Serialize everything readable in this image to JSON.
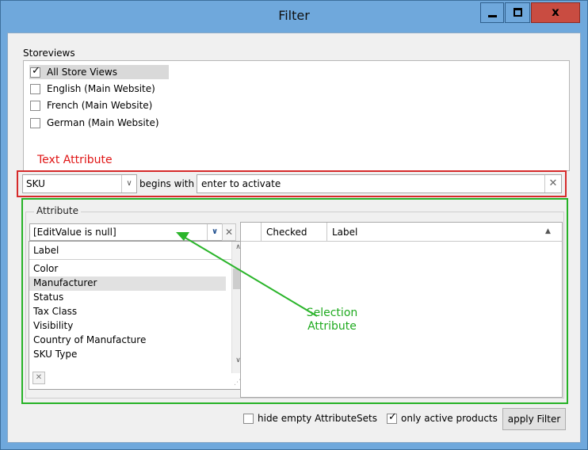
{
  "window": {
    "title": "Filter",
    "min_icon": "minimize-icon",
    "max_icon": "maximize-icon",
    "close_icon": "close-icon",
    "close_glyph": "x"
  },
  "storeviews": {
    "label": "Storeviews",
    "items": [
      {
        "label": "All Store Views",
        "checked": true
      },
      {
        "label": "English (Main Website)",
        "checked": false
      },
      {
        "label": "French (Main Website)",
        "checked": false
      },
      {
        "label": "German (Main Website)",
        "checked": false
      }
    ]
  },
  "annotations": {
    "text_attribute": "Text Attribute",
    "selection_attribute_line1": "Selection",
    "selection_attribute_line2": "Attribute",
    "red_color": "#d62a2a",
    "green_color": "#26b226"
  },
  "text_filter": {
    "field": "SKU",
    "operator": "begins with",
    "value_placeholder": "enter to activate",
    "clear_glyph": "✕"
  },
  "attribute": {
    "group_title": "Attribute",
    "combo_value": "[EditValue is null]",
    "list_header": "Label",
    "items": [
      "Color",
      "Manufacturer",
      "Status",
      "Tax Class",
      "Visibility",
      "Country of Manufacture",
      "SKU Type"
    ],
    "selected_item": "Manufacturer",
    "clear_glyph": "✕"
  },
  "grid": {
    "columns": [
      "",
      "Checked",
      "Label"
    ],
    "sort_glyph": "▲"
  },
  "footer": {
    "hide_empty_label": "hide empty AttributeSets",
    "hide_empty_checked": false,
    "only_active_label": "only active products",
    "only_active_checked": true,
    "apply_button": "apply Filter"
  }
}
